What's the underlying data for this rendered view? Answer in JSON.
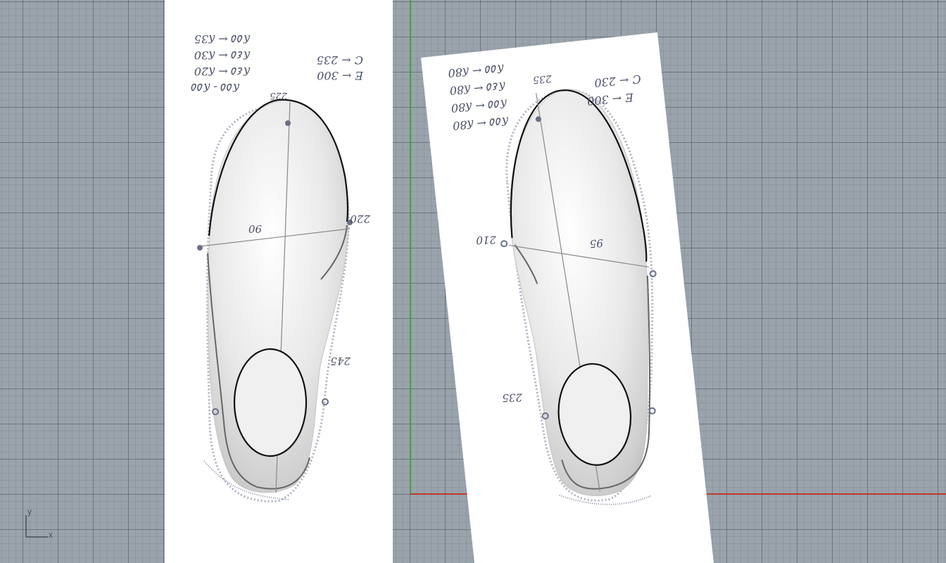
{
  "viewport": {
    "axes_widget": {
      "y_label": "y",
      "x_label": "x"
    },
    "colors": {
      "background": "#9aa2ab",
      "x_axis": "#c0392b",
      "y_axis": "#3aa53a",
      "paper": "#ffffff",
      "curve": "#111111",
      "ink": "#4a4f6a"
    }
  },
  "left_sheet": {
    "notes": [
      "ʎ٥٥ ← ʎ35",
      "ʎ٤٥ ← ʎ30",
      "ʎ٤٥ ← ʎ20",
      "ʎ٥٥ - ʎ٥٥"
    ],
    "side_notes": [
      "C ← 235",
      "E ← 300"
    ],
    "toe_mark": "225",
    "width_mark": "90",
    "right_mark": "220",
    "heel_mark": "245"
  },
  "right_sheet": {
    "notes": [
      "ʎ٥٥ ← ʎ80",
      "ʎ٤٥ ← ʎ80",
      "ʎ٥٥ ← ʎ80",
      "ʎ٥٥ ← ʎ80"
    ],
    "side_notes": [
      "C ← 230",
      "E ← 300"
    ],
    "toe_mark": "235",
    "width_mark": "95",
    "left_mark": "210",
    "heel_mark": "235"
  }
}
